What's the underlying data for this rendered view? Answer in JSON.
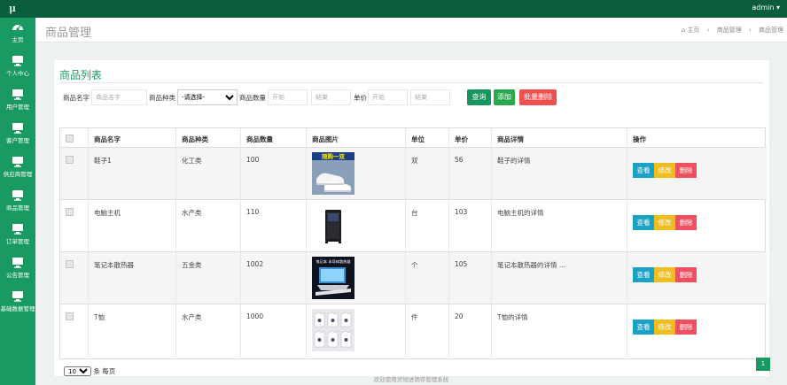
{
  "topbar": {
    "logo": "μ",
    "user": "admin ▾"
  },
  "sidebar": {
    "items": [
      {
        "label": "主页",
        "icon": "dashboard-icon"
      },
      {
        "label": "个人中心",
        "icon": "monitor-icon"
      },
      {
        "label": "用户管理",
        "icon": "monitor-icon"
      },
      {
        "label": "客户管理",
        "icon": "monitor-icon"
      },
      {
        "label": "供应商管理",
        "icon": "monitor-icon"
      },
      {
        "label": "商品管理",
        "icon": "monitor-icon"
      },
      {
        "label": "订单管理",
        "icon": "monitor-icon"
      },
      {
        "label": "公告管理",
        "icon": "monitor-icon"
      },
      {
        "label": "基础数据管理",
        "icon": "monitor-icon"
      }
    ]
  },
  "header": {
    "title": "商品管理",
    "breadcrumb": [
      "主页",
      "商品管理",
      "商品管理"
    ]
  },
  "panel": {
    "title": "商品列表"
  },
  "filter": {
    "name_label": "商品名字",
    "name_placeholder": "商品名字",
    "type_label": "商品种类",
    "type_selected": "-请选择-",
    "qty_label": "商品数量",
    "qty_start_placeholder": "开始",
    "qty_end_placeholder": "结束",
    "price_label": "单价",
    "price_start_placeholder": "开始",
    "price_end_placeholder": "结束",
    "search_label": "查询",
    "add_label": "添加",
    "batch_delete_label": "批量删除"
  },
  "table": {
    "headers": [
      "商品名字",
      "商品种类",
      "商品数量",
      "商品图片",
      "单位",
      "单价",
      "商品详情",
      "操作"
    ],
    "rows": [
      {
        "name": "鞋子1",
        "type": "化工类",
        "qty": "100",
        "unit": "双",
        "price": "56",
        "detail": "鞋子的详情",
        "image": "shoes"
      },
      {
        "name": "电脑主机",
        "type": "水产类",
        "qty": "110",
        "unit": "台",
        "price": "103",
        "detail": "电脑主机的详情",
        "image": "pc-case"
      },
      {
        "name": "笔记本散热器",
        "type": "五金类",
        "qty": "1002",
        "unit": "个",
        "price": "105",
        "detail": "笔记本散热器的详情 ...",
        "image": "cooler"
      },
      {
        "name": "T恤",
        "type": "水产类",
        "qty": "1000",
        "unit": "件",
        "price": "20",
        "detail": "T恤的详情",
        "image": "tshirts"
      }
    ],
    "actions": {
      "view": "查看",
      "edit": "修改",
      "delete": "删除"
    },
    "image_text": {
      "shoes_banner": "限购一双",
      "cooler_banner": "笔记本 半导体散热器"
    }
  },
  "pager": {
    "page_size": "10",
    "per_page_label": "条 每页",
    "current_page": "1"
  },
  "footer": {
    "text": "欢迎使用货物进销存管理系统"
  },
  "colors": {
    "topbar": "#0b5e3c",
    "sidebar": "#1a9a63",
    "accent": "#1a9a63",
    "danger": "#ef4f4f",
    "warning": "#efbd1d",
    "info": "#1aa2c4"
  }
}
